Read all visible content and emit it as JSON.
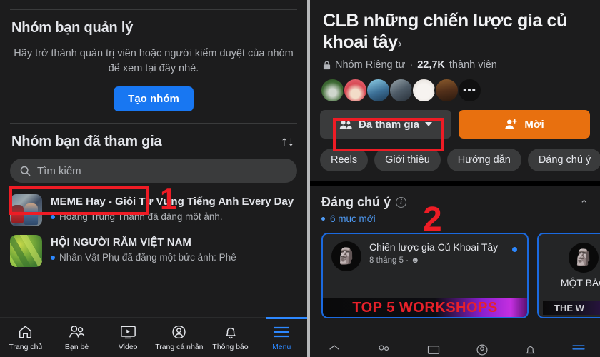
{
  "left": {
    "managed_section": {
      "title": "Nhóm bạn quản lý",
      "description": "Hãy trở thành quản trị viên hoặc người kiểm duyệt của nhóm để xem tại đây nhé.",
      "create_button": "Tạo nhóm"
    },
    "joined_section": {
      "title": "Nhóm bạn đã tham gia",
      "sort_icon": "sort-updown-icon",
      "sort_glyph": "↑↓"
    },
    "search": {
      "placeholder": "Tìm kiếm",
      "value": "",
      "icon": "search-icon"
    },
    "groups": [
      {
        "name": "MEME Hay - Giỏi Từ Vựng Tiếng Anh Every Day",
        "activity": "Hoàng Trung Thành đã đăng một ảnh."
      },
      {
        "name": "HỘI NGƯỜI RĂM VIỆT NAM",
        "activity": "Nhân Vật Phụ đã đăng một bức ảnh: Phê"
      }
    ],
    "bottom_nav": [
      {
        "label": "Trang chủ",
        "icon": "home-icon",
        "active": false
      },
      {
        "label": "Bạn bè",
        "icon": "friends-icon",
        "active": false
      },
      {
        "label": "Video",
        "icon": "video-icon",
        "active": false
      },
      {
        "label": "Trang cá nhân",
        "icon": "profile-icon",
        "active": false
      },
      {
        "label": "Thông báo",
        "icon": "bell-icon",
        "active": false
      },
      {
        "label": "Menu",
        "icon": "hamburger-menu-icon",
        "active": true
      }
    ]
  },
  "right": {
    "group_title": "CLB những chiến lược gia củ khoai tây",
    "title_chevron": "›",
    "privacy": {
      "lock_icon": "lock-icon",
      "type": "Nhóm Riêng tư",
      "separator": "·",
      "member_count": "22,7K",
      "member_label": "thành viên"
    },
    "avatars_more": "•••",
    "actions": {
      "joined_label": "Đã tham gia",
      "joined_icon": "members-group-icon",
      "joined_caret": "chevron-down-icon",
      "invite_label": "Mời",
      "invite_icon": "add-person-icon",
      "invite_color": "#e8700f"
    },
    "tabs": [
      {
        "label": "Reels"
      },
      {
        "label": "Giới thiệu"
      },
      {
        "label": "Hướng dẫn"
      },
      {
        "label": "Đáng chú ý"
      }
    ],
    "highlight": {
      "title": "Đáng chú ý",
      "info_icon": "info-icon",
      "info_glyph": "i",
      "collapse_icon": "chevron-up-icon",
      "collapse_glyph": "⌃",
      "new_items": "6 mục mới"
    },
    "cards": [
      {
        "author": "Chiến lược gia Củ Khoai Tây",
        "date": "8 tháng 5",
        "separator": "·",
        "privacy_icon": "globe-icon",
        "privacy_glyph": "☻",
        "banner_text": "TOP 5 WORKSHOPS",
        "avatar_glyph": "🗿"
      },
      {
        "title": "MỘT BÁO",
        "banner_text": "THE W",
        "avatar_glyph": "🗿"
      }
    ]
  },
  "annotations": [
    {
      "label": "1",
      "target": "search-input"
    },
    {
      "label": "2",
      "target": "joined-button"
    }
  ],
  "colors": {
    "accent_blue": "#1877f2",
    "orange": "#e8700f",
    "annotation_red": "#ee1c25",
    "background": "#1c1c1d",
    "surface": "#3a3b3c"
  }
}
